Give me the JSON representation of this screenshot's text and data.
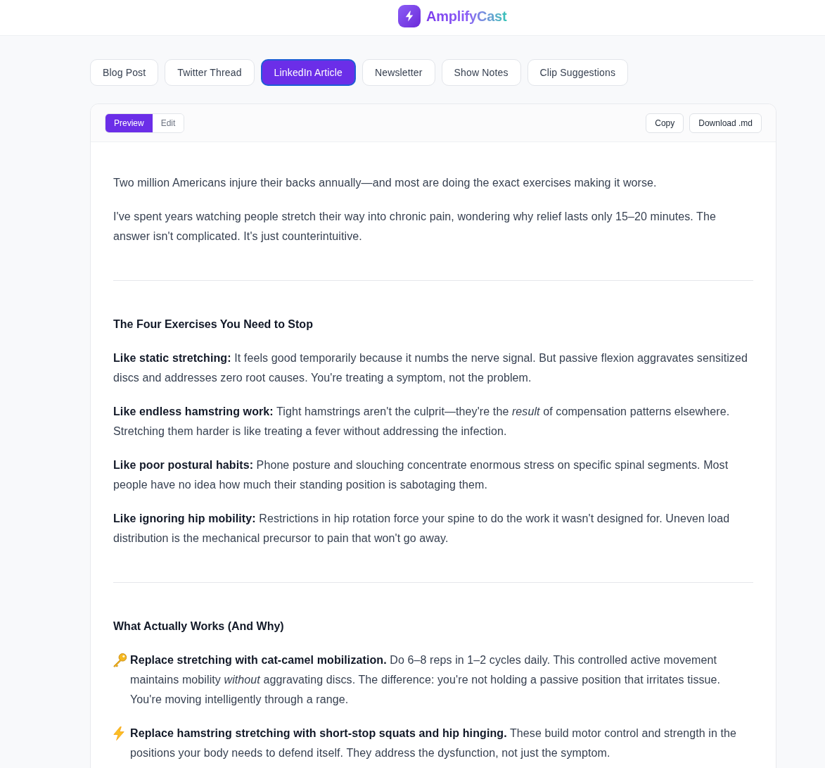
{
  "header": {
    "brand": "AmplifyCast"
  },
  "tabs": [
    {
      "label": "Blog Post",
      "selected": false
    },
    {
      "label": "Twitter Thread",
      "selected": false
    },
    {
      "label": "LinkedIn Article",
      "selected": true
    },
    {
      "label": "Newsletter",
      "selected": false
    },
    {
      "label": "Show Notes",
      "selected": false
    },
    {
      "label": "Clip Suggestions",
      "selected": false
    }
  ],
  "view_toggle": [
    {
      "label": "Preview",
      "selected": true
    },
    {
      "label": "Edit",
      "selected": false
    }
  ],
  "actions": [
    "Copy",
    "Download .md"
  ],
  "article": [
    {
      "kind": "paragraph",
      "text": "Two million Americans injure their backs annually—and most are doing the exact exercises making it worse."
    },
    {
      "kind": "paragraph",
      "text": "I've spent years watching people stretch their way into chronic pain, wondering why relief lasts only 15–20 minutes. The answer isn't complicated. It's just counterintuitive."
    },
    {
      "kind": "rule"
    },
    {
      "kind": "heading",
      "text": "The Four Exercises You Need to Stop"
    },
    {
      "kind": "paragraph",
      "text": "**Like static stretching:** It feels good temporarily because it numbs the nerve signal. But passive flexion aggravates sensitized discs and addresses zero root causes. You're treating a symptom, not the problem."
    },
    {
      "kind": "paragraph",
      "text": "**Like endless hamstring work:** Tight hamstrings aren't the culprit—they're the *result* of compensation patterns elsewhere. Stretching them harder is like treating a fever without addressing the infection."
    },
    {
      "kind": "paragraph",
      "text": "**Like poor postural habits:** Phone posture and slouching concentrate enormous stress on specific spinal segments. Most people have no idea how much their standing position is sabotaging them."
    },
    {
      "kind": "paragraph",
      "text": "**Like ignoring hip mobility:** Restrictions in hip rotation force your spine to do the work it wasn't designed for. Uneven load distribution is the mechanical precursor to pain that won't go away."
    },
    {
      "kind": "rule"
    },
    {
      "kind": "heading",
      "text": "What Actually Works (And Why)"
    },
    {
      "kind": "key_tip",
      "text": "**Replace stretching with cat-camel mobilization.** Do 6–8 reps in 1–2 cycles daily. This controlled active movement maintains mobility *without* aggravating discs. The difference: you're not holding a passive position that irritates tissue. You're moving intelligently through a range."
    },
    {
      "kind": "bolt_tip",
      "text": "**Replace hamstring stretching with short-stop squats and hip hinging.** These build motor control and strength in the positions your body needs to defend itself. They address the dysfunction, not just the symptom."
    }
  ]
}
